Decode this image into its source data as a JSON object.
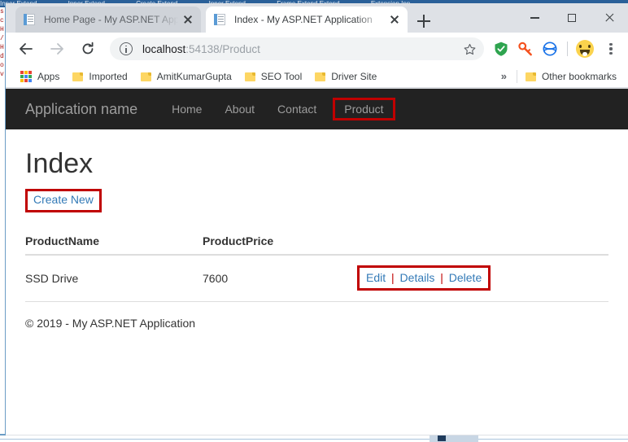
{
  "background_app": {
    "titlebar_fragments": [
      "Inner Extend",
      "Inner Extend",
      "Create Extend",
      "Inner Extend",
      "Frame Extend Extend",
      "Extension Inn"
    ],
    "code_fragments": [
      "s",
      "c",
      "H",
      "/",
      "H",
      "d",
      "o",
      "v"
    ]
  },
  "browser": {
    "tabs": [
      {
        "title": "Home Page - My ASP.NET Applic",
        "active": false,
        "favicon": "page-icon",
        "close": "close-icon"
      },
      {
        "title": "Index - My ASP.NET Application",
        "active": true,
        "favicon": "page-icon",
        "close": "close-icon"
      }
    ],
    "new_tab_tooltip": "New tab",
    "window_controls": {
      "minimize": "minimize-icon",
      "maximize": "maximize-icon",
      "close": "close-icon"
    },
    "toolbar": {
      "back": "back-arrow-icon",
      "forward": "forward-arrow-icon",
      "reload": "reload-icon",
      "site_info": "info-icon",
      "url_host": "localhost",
      "url_path": ":54138/Product",
      "bookmark_star": "star-icon",
      "extensions": [
        "shield-icon",
        "key-icon",
        "sync-circle-icon"
      ],
      "profile_avatar": "smiley-avatar",
      "menu": "kebab-menu-icon"
    },
    "bookmarks_bar": {
      "apps": {
        "label": "Apps",
        "icon": "apps-grid-icon"
      },
      "items": [
        {
          "label": "Imported",
          "icon": "folder-icon"
        },
        {
          "label": "AmitKumarGupta",
          "icon": "folder-icon"
        },
        {
          "label": "SEO Tool",
          "icon": "folder-icon"
        },
        {
          "label": "Driver Site",
          "icon": "folder-icon"
        }
      ],
      "overflow": "»",
      "other_bookmarks": {
        "label": "Other bookmarks",
        "icon": "folder-icon"
      }
    }
  },
  "page": {
    "navbar": {
      "brand": "Application name",
      "links": [
        {
          "label": "Home",
          "highlighted": false
        },
        {
          "label": "About",
          "highlighted": false
        },
        {
          "label": "Contact",
          "highlighted": false
        },
        {
          "label": "Product",
          "highlighted": true
        }
      ]
    },
    "heading": "Index",
    "create_new": "Create New",
    "table": {
      "headers": [
        "ProductName",
        "ProductPrice",
        ""
      ],
      "rows": [
        {
          "product_name": "SSD Drive",
          "product_price": "7600",
          "actions": [
            "Edit",
            "Details",
            "Delete"
          ],
          "action_separator": "|"
        }
      ]
    },
    "footer": "© 2019 - My ASP.NET Application"
  },
  "colors": {
    "highlight_box": "#c00000",
    "navbar_bg": "#222222",
    "navbar_text": "#9d9d9d",
    "link": "#337ab7",
    "tab_active_bg": "#ffffff",
    "tab_inactive_bg": "#cfd3d9",
    "chrome_frame": "#dee1e6"
  }
}
